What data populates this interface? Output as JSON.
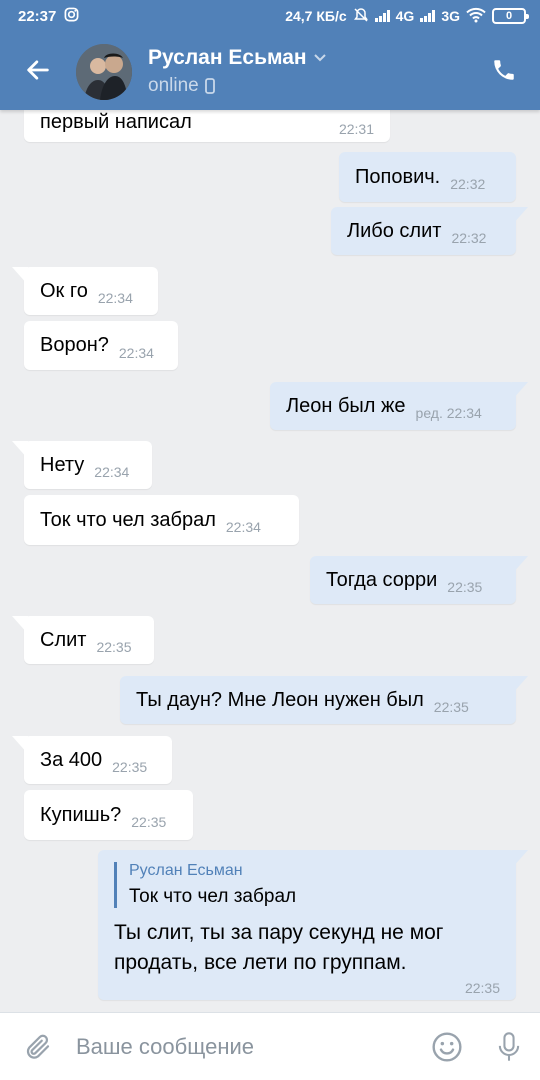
{
  "status_bar": {
    "time": "22:37",
    "speed": "24,7 КБ/с",
    "net1": "4G",
    "net2": "3G",
    "battery": "0"
  },
  "header": {
    "contact_name": "Руслан Есьман",
    "status": "online",
    "accent": "#5181b8"
  },
  "messages": [
    {
      "dir": "in",
      "text": "первый написал",
      "time": "22:31"
    },
    {
      "dir": "out",
      "text": "Попович.",
      "time": "22:32"
    },
    {
      "dir": "out",
      "text": "Либо слит",
      "time": "22:32"
    },
    {
      "dir": "in",
      "text": "Ок го",
      "time": "22:34"
    },
    {
      "dir": "in",
      "text": "Ворон?",
      "time": "22:34"
    },
    {
      "dir": "out",
      "text": "Леон был же",
      "time": "ред. 22:34"
    },
    {
      "dir": "in",
      "text": "Нету",
      "time": "22:34"
    },
    {
      "dir": "in",
      "text": "Ток что чел забрал",
      "time": "22:34"
    },
    {
      "dir": "out",
      "text": "Тогда сорри",
      "time": "22:35"
    },
    {
      "dir": "in",
      "text": "Слит",
      "time": "22:35"
    },
    {
      "dir": "out",
      "text": "Ты даун? Мне Леон нужен был",
      "time": "22:35"
    },
    {
      "dir": "in",
      "text": "За 400",
      "time": "22:35"
    },
    {
      "dir": "in",
      "text": "Купишь?",
      "time": "22:35"
    }
  ],
  "reply_message": {
    "quote_author": "Руслан Есьман",
    "quote_text": "Ток что чел забрал",
    "line1": "Ты слит, ты за пару секунд не мог",
    "line2": "продать, все лети по группам.",
    "time": "22:35"
  },
  "composer": {
    "placeholder": "Ваше сообщение"
  }
}
